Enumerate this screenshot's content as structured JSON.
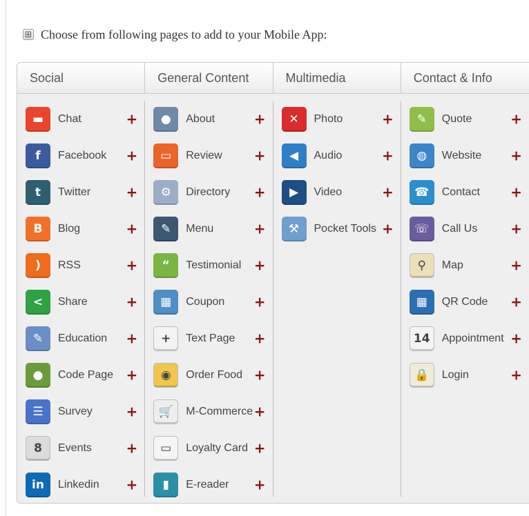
{
  "header": {
    "title": "Choose from following pages to add to your Mobile App:",
    "expand_icon": "expand-icon"
  },
  "add_symbol": "+",
  "colors": {
    "add": "#8c1512",
    "panel_bg": "#efefef"
  },
  "columns": [
    {
      "title": "Social",
      "items": [
        {
          "label": "Chat",
          "icon": "chat-icon",
          "glyph": "▬",
          "bg": "#e8452c"
        },
        {
          "label": "Facebook",
          "icon": "facebook-icon",
          "glyph": "f",
          "bg": "#3b5ba0"
        },
        {
          "label": "Twitter",
          "icon": "twitter-icon",
          "glyph": "t",
          "bg": "#2f5e73"
        },
        {
          "label": "Blog",
          "icon": "blogger-icon",
          "glyph": "B",
          "bg": "#f2712a"
        },
        {
          "label": "RSS",
          "icon": "rss-icon",
          "glyph": ")",
          "bg": "#ef6b1e"
        },
        {
          "label": "Share",
          "icon": "share-icon",
          "glyph": "<",
          "bg": "#2ea343"
        },
        {
          "label": "Education",
          "icon": "education-icon",
          "glyph": "✎",
          "bg": "#6c8ec7"
        },
        {
          "label": "Code Page",
          "icon": "code-page-icon",
          "glyph": "●",
          "bg": "#6a9c3e"
        },
        {
          "label": "Survey",
          "icon": "survey-icon",
          "glyph": "☰",
          "bg": "#4a74c9"
        },
        {
          "label": "Events",
          "icon": "events-icon",
          "glyph": "8",
          "bg": "#dcdcdc"
        },
        {
          "label": "Linkedin",
          "icon": "linkedin-icon",
          "glyph": "in",
          "bg": "#0e6ab4"
        }
      ]
    },
    {
      "title": "General Content",
      "items": [
        {
          "label": "About",
          "icon": "about-icon",
          "glyph": "●",
          "bg": "#6e8aa8"
        },
        {
          "label": "Review",
          "icon": "review-icon",
          "glyph": "▭",
          "bg": "#e8662a"
        },
        {
          "label": "Directory",
          "icon": "directory-icon",
          "glyph": "⚙",
          "bg": "#9aaec6"
        },
        {
          "label": "Menu",
          "icon": "menu-icon",
          "glyph": "✎",
          "bg": "#3d5672"
        },
        {
          "label": "Testimonial",
          "icon": "testimonial-icon",
          "glyph": "“",
          "bg": "#7bb544"
        },
        {
          "label": "Coupon",
          "icon": "coupon-icon",
          "glyph": "▦",
          "bg": "#4f8ec6"
        },
        {
          "label": "Text Page",
          "icon": "text-page-icon",
          "glyph": "+",
          "bg": "#f3f3f3"
        },
        {
          "label": "Order Food",
          "icon": "order-food-icon",
          "glyph": "◉",
          "bg": "#f2c54f"
        },
        {
          "label": "M-Commerce",
          "icon": "shopping-cart-icon",
          "glyph": "🛒",
          "bg": "#eeeeee"
        },
        {
          "label": "Loyalty Card",
          "icon": "loyalty-card-icon",
          "glyph": "▭",
          "bg": "#f5f5f5"
        },
        {
          "label": "E-reader",
          "icon": "e-reader-icon",
          "glyph": "▮",
          "bg": "#2c8fa5"
        }
      ]
    },
    {
      "title": "Multimedia",
      "items": [
        {
          "label": "Photo",
          "icon": "photo-icon",
          "glyph": "✕",
          "bg": "#d82d2a"
        },
        {
          "label": "Audio",
          "icon": "audio-icon",
          "glyph": "◀",
          "bg": "#2f7fc6"
        },
        {
          "label": "Video",
          "icon": "video-icon",
          "glyph": "▶",
          "bg": "#1d4f86"
        },
        {
          "label": "Pocket Tools",
          "icon": "pocket-tools-icon",
          "glyph": "⚒",
          "bg": "#6e9fcf"
        }
      ]
    },
    {
      "title": "Contact & Info",
      "items": [
        {
          "label": "Quote",
          "icon": "quote-icon",
          "glyph": "✎",
          "bg": "#8fbf4a"
        },
        {
          "label": "Website",
          "icon": "globe-icon",
          "glyph": "◍",
          "bg": "#3b86c8"
        },
        {
          "label": "Contact",
          "icon": "contact-icon",
          "glyph": "☎",
          "bg": "#2a8fce"
        },
        {
          "label": "Call Us",
          "icon": "call-us-icon",
          "glyph": "☏",
          "bg": "#6a5c9e"
        },
        {
          "label": "Map",
          "icon": "map-icon",
          "glyph": "⚲",
          "bg": "#e9dfb9"
        },
        {
          "label": "QR Code",
          "icon": "qr-code-icon",
          "glyph": "▦",
          "bg": "#2a6fb2"
        },
        {
          "label": "Appointment",
          "icon": "calendar-icon",
          "glyph": "14",
          "bg": "#f4f4f4"
        },
        {
          "label": "Login",
          "icon": "padlock-icon",
          "glyph": "🔒",
          "bg": "#f1ebda"
        }
      ]
    }
  ]
}
